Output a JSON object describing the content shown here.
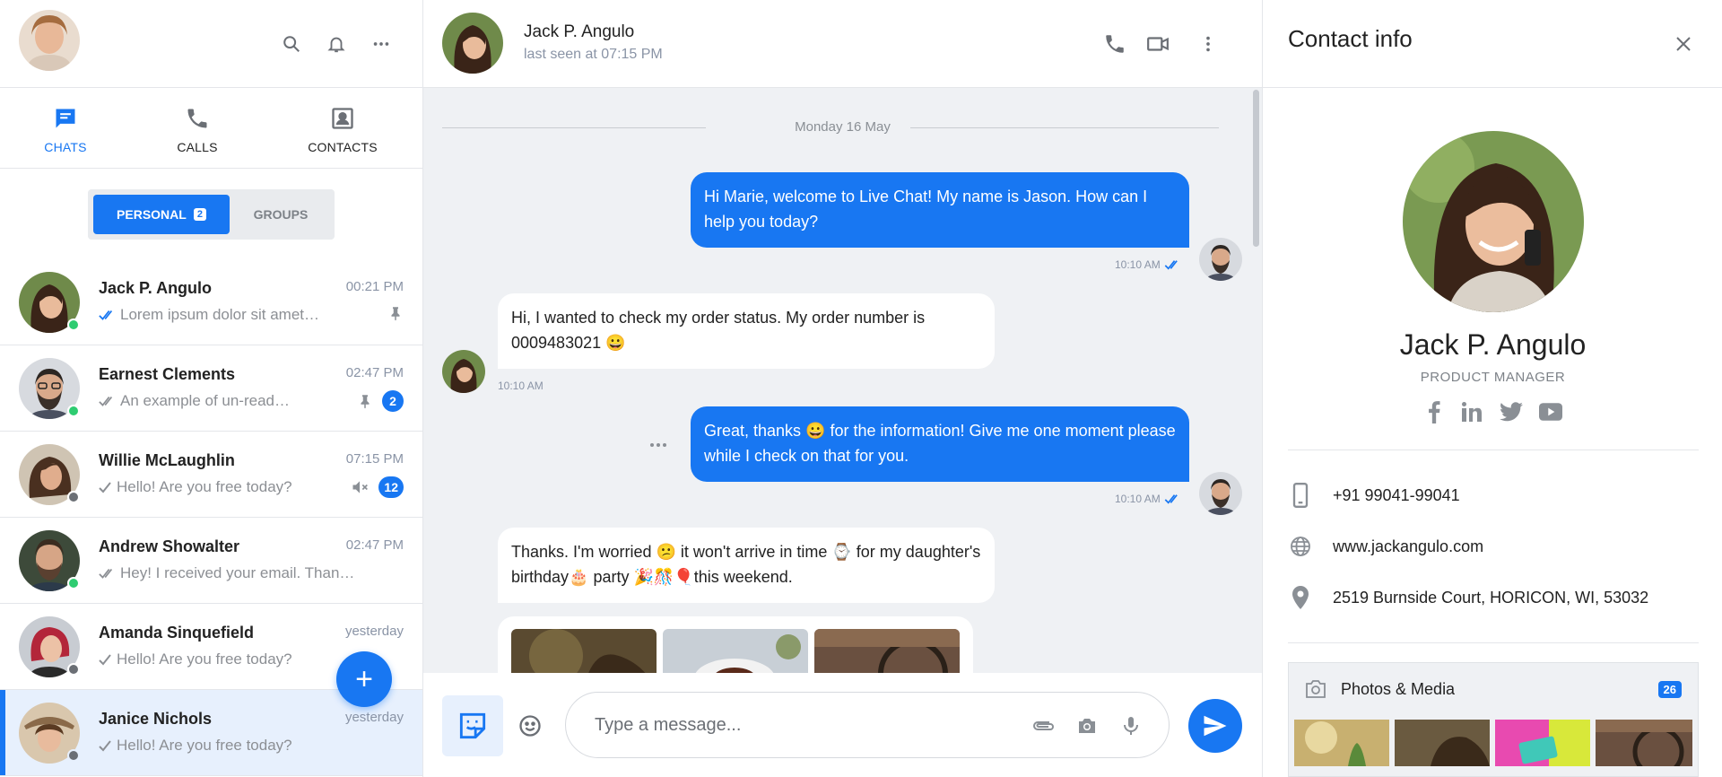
{
  "sidebar": {
    "tabs": [
      {
        "label": "CHATS",
        "icon": "chat-icon",
        "active": true
      },
      {
        "label": "CALLS",
        "icon": "phone-icon",
        "active": false
      },
      {
        "label": "CONTACTS",
        "icon": "contact-book-icon",
        "active": false
      }
    ],
    "segments": {
      "personal": "PERSONAL",
      "personal_count": "2",
      "groups": "GROUPS"
    },
    "chats": [
      {
        "name": "Jack P. Angulo",
        "time": "00:21 PM",
        "message": "Lorem ipsum dolor sit amet…",
        "ticks": "double",
        "status": "online",
        "pinned": true,
        "count": "",
        "muted": false
      },
      {
        "name": "Earnest Clements",
        "time": "02:47 PM",
        "message": "An example of un-read…",
        "ticks": "double-grey",
        "status": "online",
        "pinned": true,
        "count": "2",
        "muted": false
      },
      {
        "name": "Willie McLaughlin",
        "time": "07:15 PM",
        "message": "Hello! Are you free today?",
        "ticks": "single",
        "status": "offline",
        "pinned": false,
        "count": "12",
        "muted": true
      },
      {
        "name": "Andrew Showalter",
        "time": "02:47 PM",
        "message": "Hey! I received your email. Than…",
        "ticks": "double-grey",
        "status": "online",
        "pinned": false,
        "count": "",
        "muted": false
      },
      {
        "name": "Amanda Sinquefield",
        "time": "yesterday",
        "message": "Hello! Are you free today?",
        "ticks": "single",
        "status": "offline",
        "pinned": false,
        "count": "",
        "muted": false
      },
      {
        "name": "Janice Nichols",
        "time": "yesterday",
        "message": "Hello! Are you free today?",
        "ticks": "single",
        "status": "offline",
        "pinned": false,
        "count": "",
        "muted": false,
        "selected": true
      }
    ],
    "fab_label": "+"
  },
  "chat": {
    "contact_name": "Jack P. Angulo",
    "last_seen": "last seen at 07:15 PM",
    "date_divider": "Monday 16 May",
    "messages": [
      {
        "dir": "out",
        "text": "Hi Marie, welcome to Live Chat! My name is Jason. How can I help you today?",
        "time": "10:10 AM"
      },
      {
        "dir": "in",
        "text": "Hi, I wanted to check my order status. My order number is 0009483021 😀",
        "time": "10:10 AM"
      },
      {
        "dir": "out",
        "text": "Great, thanks 😀 for the information! Give me one moment please while I check on that for you.",
        "time": "10:10 AM"
      },
      {
        "dir": "in",
        "text": "Thanks. I'm worried 😕 it won't arrive in time ⌚ for my daughter's birthday🎂 party 🎉🎊🎈this weekend.",
        "time": ""
      }
    ],
    "input_placeholder": "Type a message..."
  },
  "info": {
    "title": "Contact info",
    "name": "Jack P. Angulo",
    "role": "PRODUCT MANAGER",
    "phone": "+91 99041-99041",
    "website": "www.jackangulo.com",
    "address": "2519 Burnside Court, HORICON, WI, 53032",
    "media_label": "Photos & Media",
    "media_count": "26"
  },
  "colors": {
    "accent": "#1877f2",
    "online": "#2ecc71",
    "offline": "#6b6f75"
  }
}
